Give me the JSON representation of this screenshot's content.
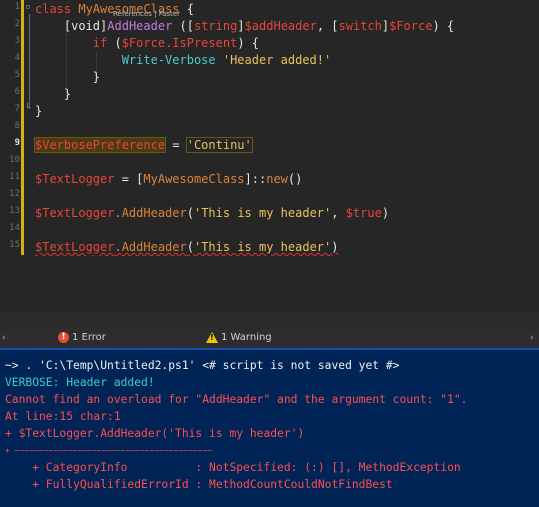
{
  "editor": {
    "codelens": "References | Faster",
    "line_numbers": [
      "1",
      "2",
      "3",
      "4",
      "5",
      "6",
      "7",
      "8",
      "9",
      "10",
      "11",
      "12",
      "13",
      "14",
      "15"
    ],
    "lines": {
      "l1": {
        "kw": "class",
        "name": "MyAwesomeClass",
        "brace": " {"
      },
      "l2": {
        "indent": "    ",
        "type": "[void]",
        "meth": "AddHeader",
        "p1": " ([",
        "ptype": "string",
        "p2": "]",
        "param": "$addHeader",
        "p3": ", [",
        "ptype2": "switch",
        "p4": "]",
        "param2": "$Force",
        "p5": ") {"
      },
      "l3": {
        "indent": "        ",
        "kw": "if",
        "p1": " (",
        "var": "$Force",
        "prop": ".IsPresent",
        "p2": ") {"
      },
      "l4": {
        "indent": "            ",
        "cmd": "Write-Verbose",
        "str": " 'Header added!'"
      },
      "l5": {
        "text": "        }"
      },
      "l6": {
        "text": "    }"
      },
      "l7": {
        "text": "}"
      },
      "l9": {
        "var": "$VerbosePreference",
        "op": " = ",
        "str": "'Continu'"
      },
      "l11": {
        "var": "$TextLogger",
        "op": " = [",
        "cls": "MyAwesomeClass",
        "op2": "]::",
        "meth": "new",
        "end": "()"
      },
      "l13": {
        "var": "$TextLogger",
        "meth": ".AddHeader",
        "p1": "(",
        "str": "'This is my header'",
        "p2": ", ",
        "var2": "$true",
        "p3": ")"
      },
      "l15": {
        "var": "$TextLogger",
        "meth": ".AddHeader",
        "p1": "(",
        "str": "'This is my header'",
        "p2": ")"
      }
    }
  },
  "errorbar": {
    "errors": "1 Error",
    "warnings": "1 Warning",
    "error_glyph": "!",
    "warn_glyph": "!"
  },
  "console": {
    "lines": [
      "~> . 'C:\\Temp\\Untitled2.ps1' <# script is not saved yet #>",
      "VERBOSE: Header added!",
      "Cannot find an overload for \"AddHeader\" and the argument count: \"1\".",
      "At line:15 char:1",
      "+ $TextLogger.AddHeader('This is my header')",
      "+ ~~~~~~~~~~~~~~~~~~~~~~~~~~~~~~~~~~~~~~~~~",
      "    + CategoryInfo          : NotSpecified: (:) [], MethodException",
      "    + FullyQualifiedErrorId : MethodCountCouldNotFindBest"
    ]
  },
  "colors": {
    "console_bg": "#012456",
    "editor_bg": "#262626",
    "error_red": "#ff4d4d",
    "verbose_cyan": "#3fc9c9"
  }
}
